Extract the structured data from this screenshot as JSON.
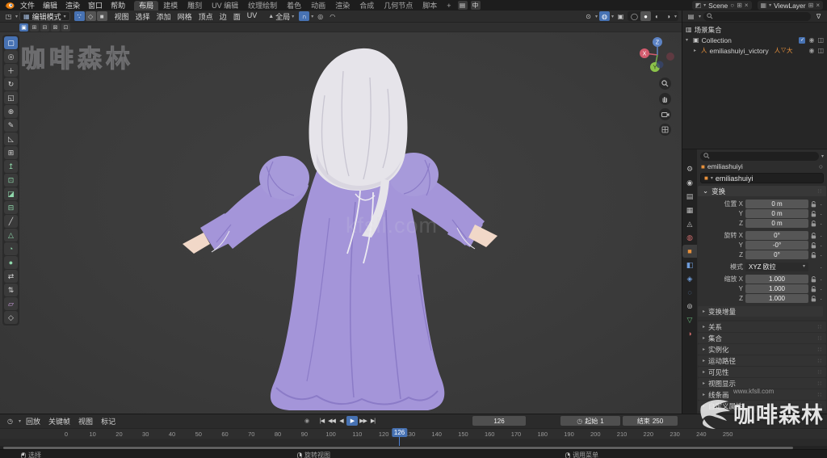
{
  "topbar": {
    "menus": [
      "文件",
      "编辑",
      "渲染",
      "窗口",
      "帮助"
    ],
    "workspaces": [
      {
        "label": "布局",
        "active": true
      },
      {
        "label": "建模"
      },
      {
        "label": "雕刻"
      },
      {
        "label": "UV 编辑"
      },
      {
        "label": "纹理绘制"
      },
      {
        "label": "着色"
      },
      {
        "label": "动画"
      },
      {
        "label": "渲染"
      },
      {
        "label": "合成"
      },
      {
        "label": "几何节点"
      },
      {
        "label": "脚本"
      }
    ],
    "add_workspace": "+",
    "ime": {
      "kbd": "▤",
      "lang": "中"
    },
    "scene_label": "Scene",
    "viewlayer_label": "ViewLayer"
  },
  "viewport_header": {
    "mode": "编辑模式",
    "menus": [
      "视图",
      "选择",
      "添加",
      "网格",
      "顶点",
      "边",
      "面",
      "UV"
    ],
    "orientation": "全局"
  },
  "tool_settings_modes": [
    {
      "glyph": "▣",
      "active": true
    },
    {
      "glyph": "⊞"
    },
    {
      "glyph": "⊟"
    },
    {
      "glyph": "⊠"
    },
    {
      "glyph": "⊡"
    }
  ],
  "tools": [
    {
      "glyph": "▢",
      "name": "框选",
      "tone": "mono",
      "active": true
    },
    {
      "glyph": "◎",
      "name": "游标",
      "tone": "mono"
    },
    {
      "glyph": "＋",
      "name": "移动",
      "tone": "mono"
    },
    {
      "glyph": "↻",
      "name": "旋转",
      "tone": "mono"
    },
    {
      "glyph": "◱",
      "name": "缩放",
      "tone": "mono"
    },
    {
      "glyph": "⊕",
      "name": "变换",
      "tone": "mono"
    },
    {
      "glyph": "✎",
      "name": "标注",
      "tone": "mono"
    },
    {
      "glyph": "◺",
      "name": "测量",
      "tone": "mono"
    },
    {
      "glyph": "⊞",
      "name": "添加立方体",
      "tone": "mono"
    },
    {
      "glyph": "↥",
      "name": "挤出选区",
      "tone": "green"
    },
    {
      "glyph": "⊡",
      "name": "内插面",
      "tone": "green"
    },
    {
      "glyph": "◪",
      "name": "倒角",
      "tone": "green"
    },
    {
      "glyph": "⊟",
      "name": "环切",
      "tone": "green"
    },
    {
      "glyph": "╱",
      "name": "切割",
      "tone": "mono"
    },
    {
      "glyph": "△",
      "name": "多边形建形",
      "tone": "green"
    },
    {
      "glyph": "◔",
      "name": "旋绕",
      "tone": "green"
    },
    {
      "glyph": "●",
      "name": "光滑",
      "tone": "green"
    },
    {
      "glyph": "⇄",
      "name": "滑移边线",
      "tone": "mono"
    },
    {
      "glyph": "⇅",
      "name": "收缩/平展",
      "tone": "mono"
    },
    {
      "glyph": "▱",
      "name": "切变",
      "tone": "purple"
    },
    {
      "glyph": "◇",
      "name": "断离区域",
      "tone": "mono"
    }
  ],
  "gizmo_axes": [
    "X",
    "Y",
    "Z"
  ],
  "outliner": {
    "scene_collection": "场景集合",
    "collection": "Collection",
    "object": "emiliashuiyi_victory",
    "badges": [
      "人",
      "▽",
      "大"
    ]
  },
  "properties": {
    "breadcrumb": "emiliashuiyi",
    "object_name": "emiliashuiyi",
    "tabs": [
      {
        "glyph": "⚙",
        "name": "tool",
        "color": "#bdbdbd"
      },
      {
        "glyph": "◉",
        "name": "render",
        "color": "#bdbdbd"
      },
      {
        "glyph": "▤",
        "name": "output",
        "color": "#bdbdbd"
      },
      {
        "glyph": "▦",
        "name": "view-layer",
        "color": "#bdbdbd"
      },
      {
        "glyph": "◬",
        "name": "scene",
        "color": "#bdbdbd"
      },
      {
        "glyph": "◍",
        "name": "world",
        "color": "#c96a6a"
      },
      {
        "glyph": "■",
        "name": "object",
        "color": "#e8913c",
        "active": true
      },
      {
        "glyph": "◧",
        "name": "modifiers",
        "color": "#6f9ddb"
      },
      {
        "glyph": "◈",
        "name": "particles",
        "color": "#6f9ddb"
      },
      {
        "glyph": "◌",
        "name": "physics",
        "color": "#6f9ddb"
      },
      {
        "glyph": "⊚",
        "name": "constraints",
        "color": "#bdbdbd"
      },
      {
        "glyph": "▽",
        "name": "object-data",
        "color": "#67b579"
      },
      {
        "glyph": "◑",
        "name": "material",
        "color": "#c96a6a"
      }
    ],
    "transform_title": "变换",
    "location": [
      {
        "label": "位置 X",
        "value": "0 m"
      },
      {
        "label": "Y",
        "value": "0 m"
      },
      {
        "label": "Z",
        "value": "0 m"
      }
    ],
    "rotation": [
      {
        "label": "旋转 X",
        "value": "0°"
      },
      {
        "label": "Y",
        "value": "-0°"
      },
      {
        "label": "Z",
        "value": "0°"
      }
    ],
    "mode_row": {
      "label": "模式",
      "value": "XYZ 欧拉"
    },
    "scale": [
      {
        "label": "缩放 X",
        "value": "1.000"
      },
      {
        "label": "Y",
        "value": "1.000"
      },
      {
        "label": "Z",
        "value": "1.000"
      }
    ],
    "delta": "变换增量",
    "sections": [
      "关系",
      "集合",
      "实例化",
      "运动路径",
      "可见性",
      "视图显示",
      "线条画",
      "自定义属性"
    ]
  },
  "timeline": {
    "menus": [
      "回放",
      "关键帧",
      "视图",
      "标记"
    ],
    "playback": [
      {
        "glyph": "|◀"
      },
      {
        "glyph": "◀◀"
      },
      {
        "glyph": "◀"
      },
      {
        "glyph": "▶",
        "play": true
      },
      {
        "glyph": "▶▶"
      },
      {
        "glyph": "▶|"
      }
    ],
    "current_frame": "126",
    "start_label": "起始",
    "start_value": "1",
    "end_label": "结束",
    "end_value": "250",
    "playhead": {
      "label": "126",
      "style": "left:48.3%"
    },
    "ticks": [
      {
        "v": "0",
        "pos": "8%"
      },
      {
        "v": "10",
        "pos": "11.2%"
      },
      {
        "v": "20",
        "pos": "14.4%"
      },
      {
        "v": "30",
        "pos": "17.6%"
      },
      {
        "v": "40",
        "pos": "20.8%"
      },
      {
        "v": "50",
        "pos": "24%"
      },
      {
        "v": "60",
        "pos": "27.2%"
      },
      {
        "v": "70",
        "pos": "30.4%"
      },
      {
        "v": "80",
        "pos": "33.6%"
      },
      {
        "v": "90",
        "pos": "36.8%"
      },
      {
        "v": "100",
        "pos": "40%"
      },
      {
        "v": "110",
        "pos": "43.2%"
      },
      {
        "v": "120",
        "pos": "46.4%"
      },
      {
        "v": "130",
        "pos": "49.6%"
      },
      {
        "v": "140",
        "pos": "52.8%"
      },
      {
        "v": "150",
        "pos": "56%"
      },
      {
        "v": "160",
        "pos": "59.2%"
      },
      {
        "v": "170",
        "pos": "62.4%"
      },
      {
        "v": "180",
        "pos": "65.6%"
      },
      {
        "v": "190",
        "pos": "68.8%"
      },
      {
        "v": "200",
        "pos": "72%"
      },
      {
        "v": "210",
        "pos": "75.2%"
      },
      {
        "v": "220",
        "pos": "78.4%"
      },
      {
        "v": "230",
        "pos": "81.6%"
      },
      {
        "v": "240",
        "pos": "84.8%"
      },
      {
        "v": "250",
        "pos": "88%"
      }
    ]
  },
  "statusbar": [
    {
      "label": "选择"
    },
    {
      "label": "旋转视图"
    },
    {
      "label": "调用菜单"
    }
  ],
  "watermarks": {
    "outline": "咖啡森林",
    "center": "kfsll.com",
    "brand": "咖啡森林",
    "url": "www.kfsll.com"
  },
  "icons": {
    "caret": "▾",
    "caret_small": "⌄",
    "expand": "▸",
    "editor_3d": "◳",
    "grid": "▦",
    "vertex_mode": "∵",
    "edge_mode": "◇",
    "face_mode": "■",
    "orientation": "▲",
    "snap": "∩",
    "prop_edit": "◎",
    "falloff": "◠",
    "pivot": "⊙",
    "overlays": "◍",
    "xray": "▣",
    "shade_wire": "◯",
    "shade_solid": "●",
    "shade_material": "◐",
    "shade_render": "◑",
    "scene": "◩",
    "viewlayer": "▦",
    "pin": "○",
    "new": "⊞",
    "close": "×",
    "collection_menu": "▤",
    "filter": "∇",
    "scene_collection": "▥",
    "collection": "▣",
    "armature": "人",
    "eye": "◉",
    "camera": "◫",
    "check": "✓",
    "object": "■",
    "grip": "∷",
    "dot": "·",
    "timeline_clock": "◷",
    "record": "◉"
  },
  "accent_colors": {
    "selection_blue": "#4772b3",
    "object_orange": "#e8913c",
    "dress_purple": "#a495d9",
    "hair_white": "#e6e4ea"
  }
}
